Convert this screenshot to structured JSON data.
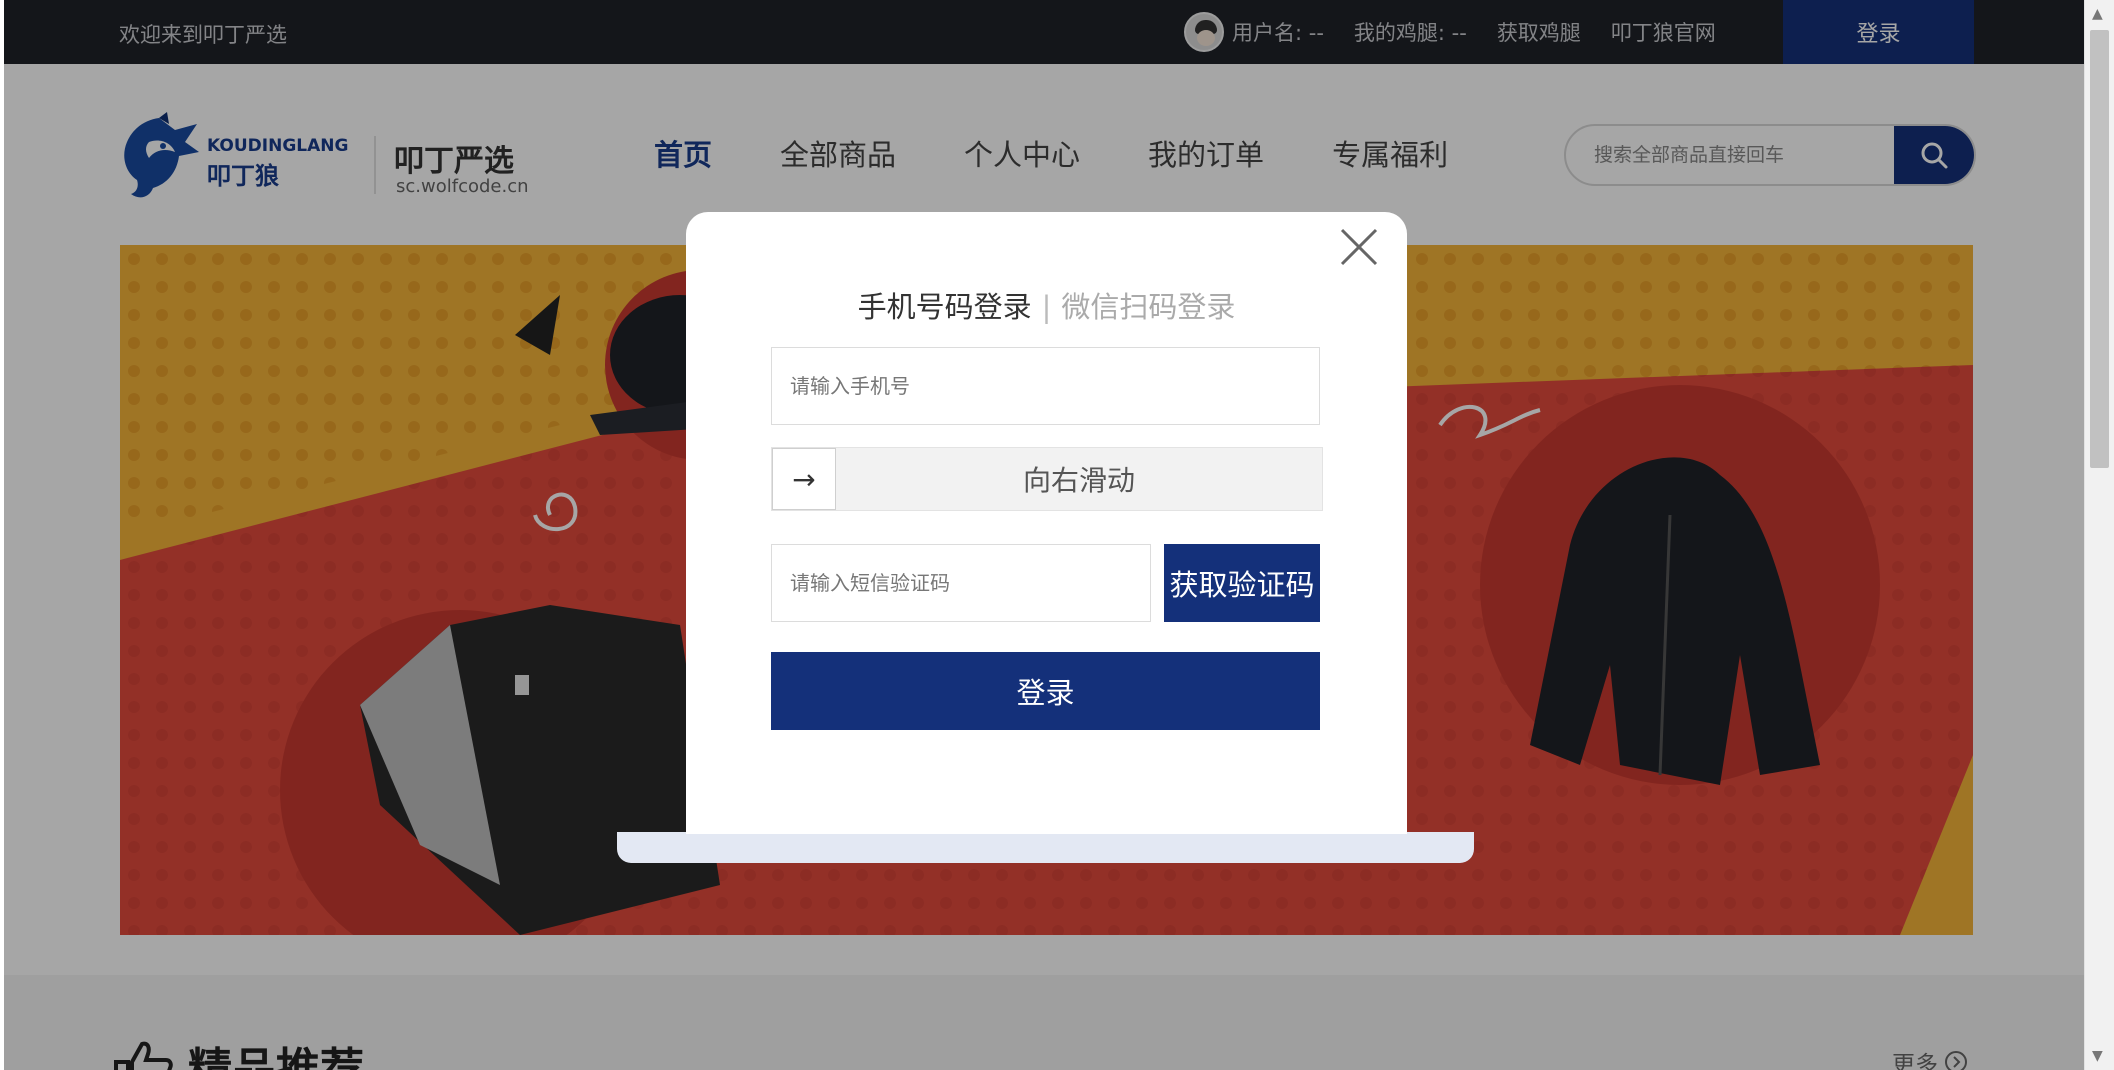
{
  "topbar": {
    "welcome": "欢迎来到叩丁严选",
    "username": "用户名: --",
    "points": "我的鸡腿: --",
    "get_points": "获取鸡腿",
    "official_site": "叩丁狼官网",
    "login": "登录"
  },
  "logo": {
    "en_text": "KOUDINGLANG",
    "cn_text": "叩丁狼",
    "title": "叩丁严选",
    "subtitle": "sc.wolfcode.cn"
  },
  "nav": {
    "items": [
      {
        "label": "首页",
        "active": true
      },
      {
        "label": "全部商品",
        "active": false
      },
      {
        "label": "个人中心",
        "active": false
      },
      {
        "label": "我的订单",
        "active": false
      },
      {
        "label": "专属福利",
        "active": false
      }
    ]
  },
  "search": {
    "placeholder": "搜索全部商品直接回车",
    "icon": "search-icon"
  },
  "section": {
    "title": "精品推荐",
    "more": "更多"
  },
  "modal": {
    "tab_phone": "手机号码登录",
    "separator": "|",
    "tab_wechat": "微信扫码登录",
    "phone_placeholder": "请输入手机号",
    "slider_label": "向右滑动",
    "slider_icon": "→",
    "sms_placeholder": "请输入短信验证码",
    "get_code": "获取验证码",
    "submit": "登录"
  },
  "colors": {
    "brand": "#14307a",
    "topbar_bg": "#1f2229",
    "banner_yellow": "#f4b43a",
    "banner_red": "#e24b3d"
  }
}
